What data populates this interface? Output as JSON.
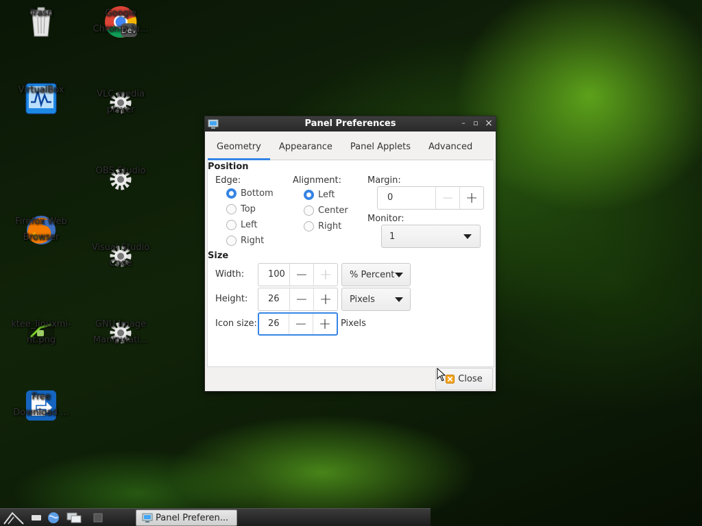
{
  "desktop": {
    "icons": [
      {
        "label": "Trash",
        "icon": "trash-icon"
      },
      {
        "label": "Google\nChrome (u...",
        "icon": "chrome-dev-icon",
        "badge": "Dev"
      },
      {
        "label": "VirtualBox",
        "icon": "virtualbox-icon"
      },
      {
        "label": "VLC media\nplayer",
        "icon": "gear-icon"
      },
      {
        "label": "OBS Studio",
        "icon": "gear-icon"
      },
      {
        "label": "Firefox Web\nBrowser",
        "icon": "firefox-icon"
      },
      {
        "label": "Visual Studio\nCode",
        "icon": "gear-icon"
      },
      {
        "label": "ktee_linuxmi-\nnt.png",
        "icon": "image-thumbnail-icon"
      },
      {
        "label": "GNU Image\nManipulati...",
        "icon": "gear-icon"
      },
      {
        "label": "Free\nDownload ...",
        "icon": "free-download-manager-icon"
      }
    ]
  },
  "window": {
    "title": "Panel Preferences",
    "controls": {
      "minimize": "–",
      "maximize": "▫",
      "close": "×"
    },
    "tabs": [
      {
        "label": "Geometry",
        "active": true
      },
      {
        "label": "Appearance",
        "active": false
      },
      {
        "label": "Panel Applets",
        "active": false
      },
      {
        "label": "Advanced",
        "active": false
      }
    ],
    "position": {
      "title": "Position",
      "edge": {
        "label": "Edge:",
        "options": [
          "Bottom",
          "Top",
          "Left",
          "Right"
        ],
        "selected": "Bottom"
      },
      "alignment": {
        "label": "Alignment:",
        "options": [
          "Left",
          "Center",
          "Right"
        ],
        "selected": "Left"
      },
      "margin": {
        "label": "Margin:",
        "value": "0",
        "minus": "−",
        "plus": "+"
      },
      "monitor": {
        "label": "Monitor:",
        "value": "1"
      }
    },
    "size": {
      "title": "Size",
      "width": {
        "label": "Width:",
        "value": "100",
        "unit": "% Percent"
      },
      "height": {
        "label": "Height:",
        "value": "26",
        "unit": "Pixels"
      },
      "icon_size": {
        "label": "Icon size:",
        "value": "26",
        "unit": "Pixels"
      },
      "minus": "−",
      "plus": "+"
    },
    "close_label": "Close"
  },
  "taskbar": {
    "task_label": "Panel Preferen..."
  },
  "colors": {
    "accent": "#3584e4",
    "titlebar": "#2f2f2f",
    "window_bg": "#f2f1f0"
  }
}
